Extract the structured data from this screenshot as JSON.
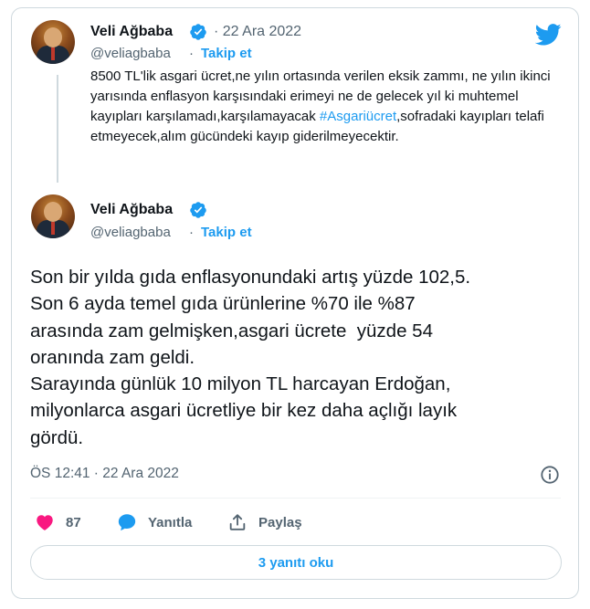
{
  "colors": {
    "accent": "#1d9bf0",
    "like": "#f91880",
    "text": "#0f1419",
    "muted": "#536471"
  },
  "quoted_tweet": {
    "author_name": "Veli Ağbaba",
    "handle": "@veliagbaba",
    "follow_label": "Takip et",
    "date": "22 Ara 2022",
    "text_before": "8500 TL'lik asgari ücret,ne yılın ortasında verilen eksik zammı, ne yılın ikinci yarısında enflasyon karşısındaki erimeyi ne de gelecek yıl ki muhtemel kayıpları karşılamadı,karşılamayacak ",
    "hashtag": "#Asgariücret",
    "text_after": ",sofradaki kayıpları telafi etmeyecek,alım gücündeki kayıp giderilmeyecektir."
  },
  "main_tweet": {
    "author_name": "Veli Ağbaba",
    "handle": "@veliagbaba",
    "follow_label": "Takip et",
    "lines": [
      "Son bir yılda gıda enflasyonundaki artış yüzde 102,5.",
      "Son 6 ayda temel gıda ürünlerine %70 ile %87",
      "arasında zam gelmişken,asgari ücrete  yüzde 54",
      "oranında zam geldi.",
      "Sarayında günlük 10 milyon TL harcayan Erdoğan,",
      "milyonlarca asgari ücretliye bir kez daha açlığı layık",
      "gördü."
    ],
    "timestamp": "ÖS 12:41 · 22 Ara 2022"
  },
  "actions": {
    "like_count": "87",
    "reply_label": "Yanıtla",
    "share_label": "Paylaş"
  },
  "read_replies_label": "3 yanıtı oku"
}
